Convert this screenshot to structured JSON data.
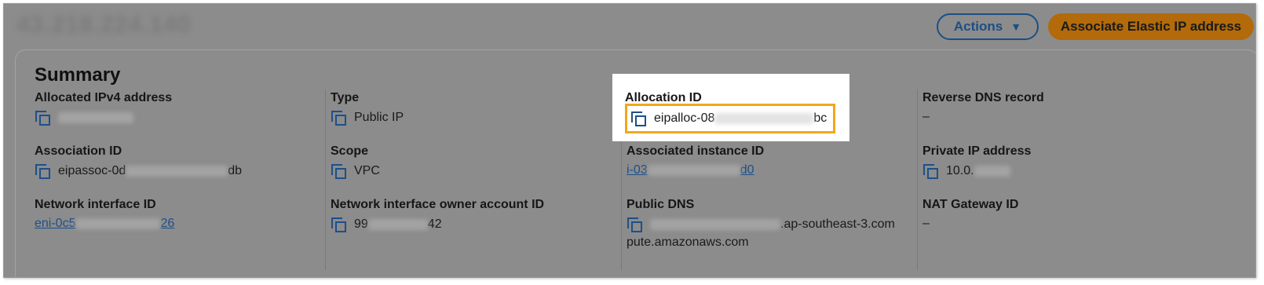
{
  "header": {
    "title": "43.218.224.140",
    "actions_label": "Actions",
    "primary_label": "Associate Elastic IP address"
  },
  "summary": {
    "title": "Summary",
    "columns": [
      {
        "fields": [
          {
            "label": "Allocated IPv4 address",
            "value": "43.218.224.140"
          },
          {
            "label": "Association ID",
            "prefix": "eipassoc-0d",
            "suffix": "db"
          },
          {
            "label": "Network interface ID",
            "prefix": "eni-0c5",
            "suffix": "26"
          }
        ]
      },
      {
        "fields": [
          {
            "label": "Type",
            "value": "Public IP"
          },
          {
            "label": "Scope",
            "value": "VPC"
          },
          {
            "label": "Network interface owner account ID",
            "prefix": "99",
            "suffix": "42"
          }
        ]
      },
      {
        "fields": [
          {
            "label": "Allocation ID",
            "prefix": "eipalloc-08",
            "suffix": "bc"
          },
          {
            "label": "Associated instance ID",
            "prefix": "i-03",
            "suffix": "d0"
          },
          {
            "label": "Public DNS",
            "suffix": ".ap-southeast-3.com",
            "line2": "pute.amazonaws.com"
          }
        ]
      },
      {
        "fields": [
          {
            "label": "Reverse DNS record",
            "value": "–"
          },
          {
            "label": "Private IP address",
            "prefix": "10.0."
          },
          {
            "label": "NAT Gateway ID",
            "value": "–"
          }
        ]
      }
    ]
  },
  "colors": {
    "overlay": "#8c8c8c",
    "highlight_border": "#f0a81a",
    "link": "#1d4f8a"
  },
  "icons": [
    "copy-icon",
    "caret-down-icon"
  ]
}
